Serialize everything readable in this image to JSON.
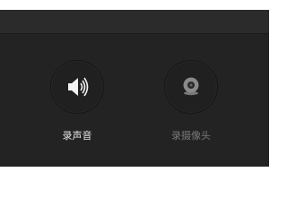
{
  "options": [
    {
      "label": "录声音",
      "icon": "speaker-icon",
      "state": "enabled"
    },
    {
      "label": "录摄像头",
      "icon": "webcam-icon",
      "state": "disabled"
    }
  ],
  "colors": {
    "panel_bg": "#232323",
    "header_bg": "#2b2b2b",
    "enabled_text": "#e6e6e6",
    "disabled_text": "#7a7a7a"
  }
}
